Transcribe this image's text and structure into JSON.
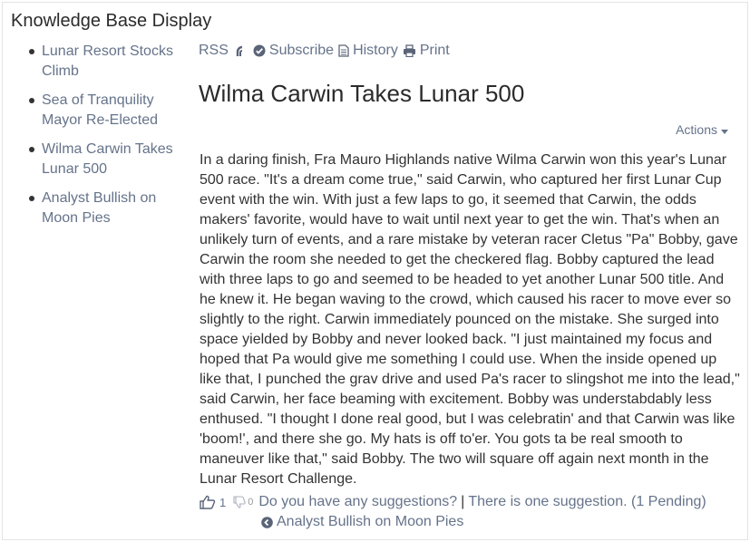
{
  "portlet": {
    "title": "Knowledge Base Display"
  },
  "nav": {
    "items": [
      {
        "label": "Lunar Resort Stocks Climb"
      },
      {
        "label": "Sea of Tranquility Mayor Re-Elected"
      },
      {
        "label": "Wilma Carwin Takes Lunar 500"
      },
      {
        "label": "Analyst Bullish on Moon Pies"
      }
    ]
  },
  "toolbar": {
    "rss_label": "RSS",
    "subscribe_label": "Subscribe",
    "history_label": "History",
    "print_label": "Print"
  },
  "article": {
    "title": "Wilma Carwin Takes Lunar 500",
    "actions_label": "Actions",
    "body": "In a daring finish, Fra Mauro Highlands native Wilma Carwin won this year's Lunar 500 race. \"It's a dream come true,\" said Carwin, who captured her first Lunar Cup event with the win. With just a few laps to go, it seemed that Carwin, the odds makers' favorite, would have to wait until next year to get the win. That's when an unlikely turn of events, and a rare mistake by veteran racer Cletus \"Pa\" Bobby, gave Carwin the room she needed to get the checkered flag. Bobby captured the lead with three laps to go and seemed to be headed to yet another Lunar 500 title. And he knew it. He began waving to the crowd, which caused his racer to move ever so slightly to the right. Carwin immediately pounced on the mistake. She surged into space yielded by Bobby and never looked back. \"I just maintained my focus and hoped that Pa would give me something I could use. When the inside opened up like that, I punched the grav drive and used Pa's racer to slingshot me into the lead,\" said Carwin, her face beaming with excitement. Bobby was understabdably less enthused. \"I thought I done real good, but I was celebratin' and that Carwin was like 'boom!', and there she go. My hats is off to'er. You gots ta be real smooth to maneuver like that,\" said Bobby. The two will square off again next month in the Lunar Resort Challenge."
  },
  "footer": {
    "thumbs_up_count": "1",
    "thumbs_down_count": "0",
    "suggestions_prompt": "Do you have any suggestions?",
    "separator": "|",
    "suggestion_count": "There is one suggestion. (1 Pending)",
    "previous_article": "Analyst Bullish on Moon Pies"
  }
}
